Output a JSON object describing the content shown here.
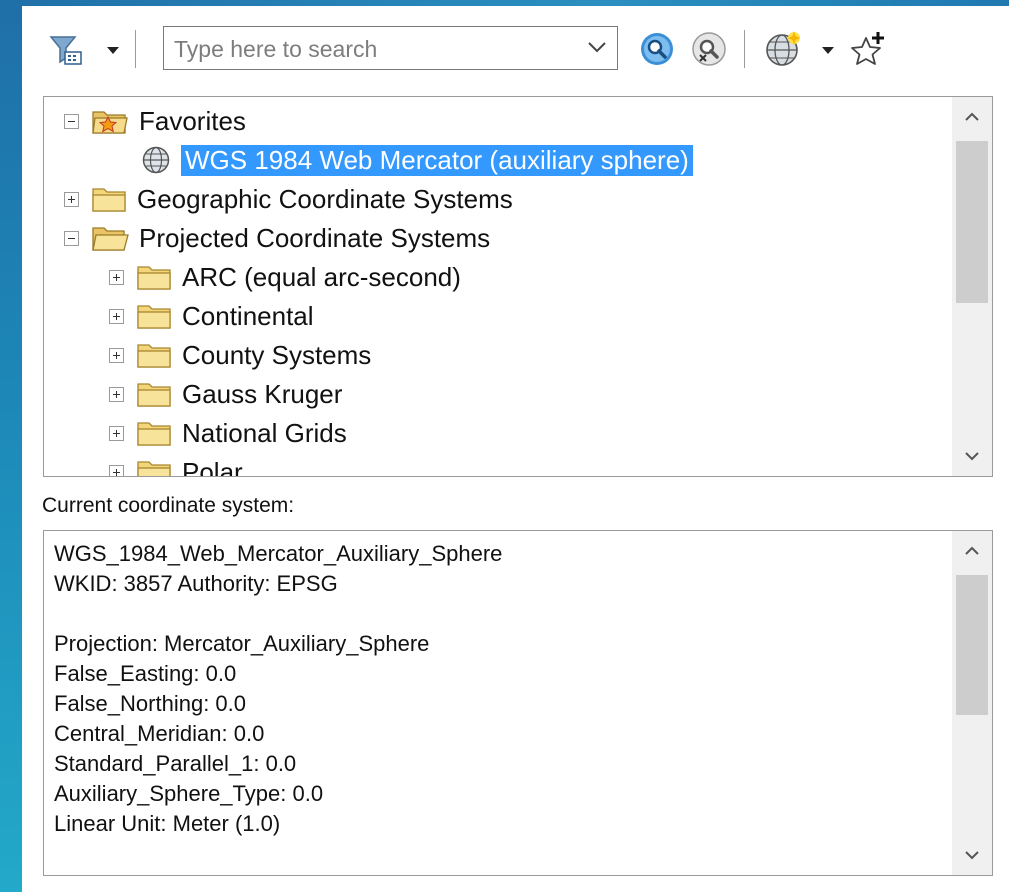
{
  "toolbar": {
    "filter_icon": "filter-icon",
    "search": {
      "placeholder": "Type here to search",
      "value": ""
    },
    "search_button_icon": "magnifier-icon",
    "clear_search_icon": "clear-search-icon",
    "globe_icon": "globe-add-icon",
    "favorite_icon": "star-add-icon"
  },
  "tree": {
    "nodes": [
      {
        "label": "Favorites",
        "expander": "minus",
        "icon": "favorites-folder-icon"
      },
      {
        "label": "WGS 1984 Web Mercator (auxiliary sphere)",
        "expander": "none",
        "icon": "globe-icon",
        "selected": true
      },
      {
        "label": "Geographic Coordinate Systems",
        "expander": "plus",
        "icon": "folder-icon"
      },
      {
        "label": "Projected Coordinate Systems",
        "expander": "minus",
        "icon": "folder-open-icon"
      },
      {
        "label": "ARC (equal arc-second)",
        "expander": "plus",
        "icon": "folder-icon"
      },
      {
        "label": "Continental",
        "expander": "plus",
        "icon": "folder-icon"
      },
      {
        "label": "County Systems",
        "expander": "plus",
        "icon": "folder-icon"
      },
      {
        "label": "Gauss Kruger",
        "expander": "plus",
        "icon": "folder-icon"
      },
      {
        "label": "National Grids",
        "expander": "plus",
        "icon": "folder-icon"
      },
      {
        "label": "Polar",
        "expander": "plus",
        "icon": "folder-icon"
      }
    ]
  },
  "current": {
    "label": "Current coordinate system:",
    "lines": [
      "WGS_1984_Web_Mercator_Auxiliary_Sphere",
      "WKID: 3857 Authority: EPSG",
      "",
      "Projection: Mercator_Auxiliary_Sphere",
      "False_Easting: 0.0",
      "False_Northing: 0.0",
      "Central_Meridian: 0.0",
      "Standard_Parallel_1: 0.0",
      "Auxiliary_Sphere_Type: 0.0",
      "Linear Unit: Meter (1.0)"
    ]
  }
}
